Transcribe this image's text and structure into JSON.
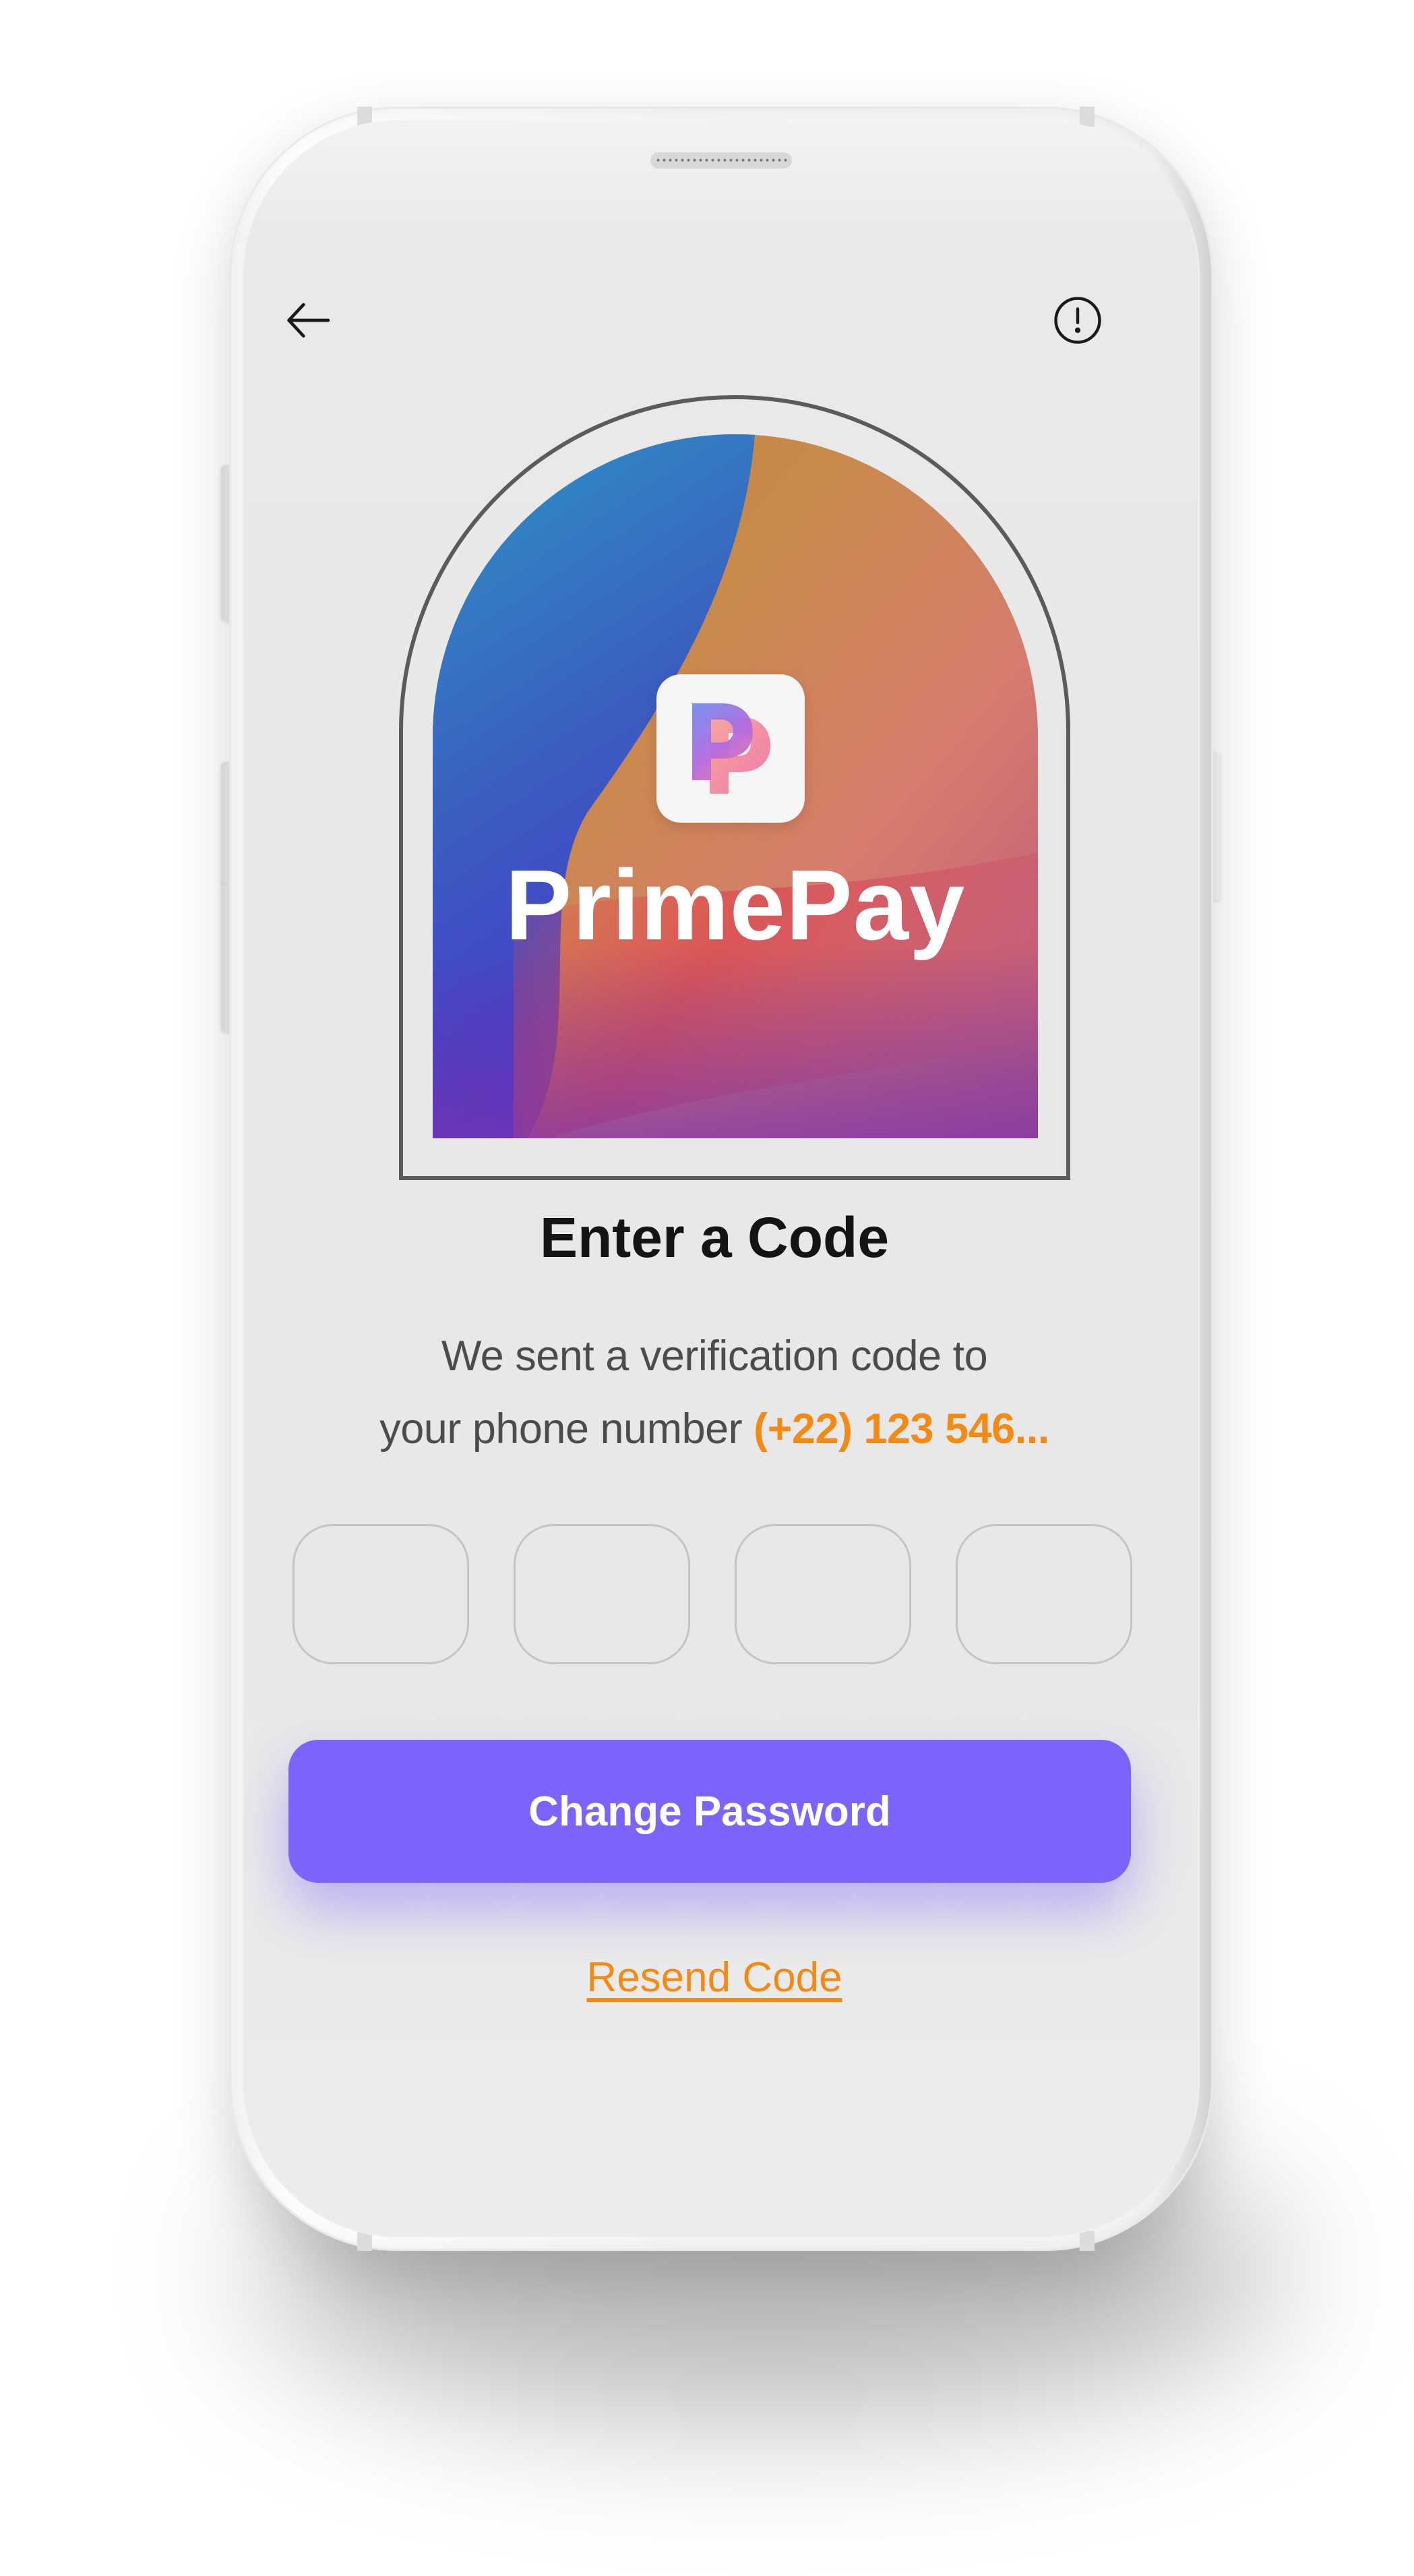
{
  "header": {
    "back_icon": "arrow-left-icon",
    "info_icon": "alert-circle-icon"
  },
  "hero": {
    "brand_name": "PrimePay",
    "logo_icon": "primepay-p-logo"
  },
  "verification": {
    "title": "Enter a Code",
    "message_line1": "We sent a verification code to",
    "message_line2_prefix": "your phone number ",
    "phone_number": "(+22) 123 546...",
    "code_digits": [
      "",
      "",
      "",
      ""
    ]
  },
  "actions": {
    "primary_label": "Change Password",
    "resend_label": "Resend Code"
  },
  "colors": {
    "accent": "#7d62fc",
    "highlight": "#f28a14",
    "text_primary": "#141414",
    "text_secondary": "#4c4c4c",
    "screen_bg": "#e9e9e9"
  }
}
